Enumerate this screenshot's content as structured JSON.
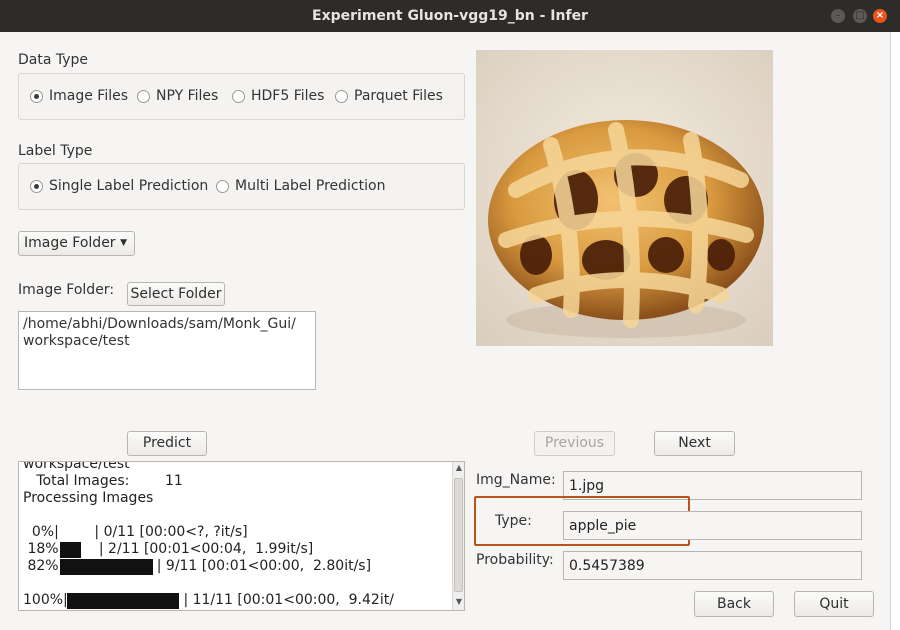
{
  "window": {
    "title": "Experiment Gluon-vgg19_bn - Infer",
    "minimize_glyph": "–",
    "maximize_glyph": "□",
    "close_glyph": "×"
  },
  "data_type": {
    "label": "Data Type",
    "options": [
      "Image Files",
      "NPY Files",
      "HDF5 Files",
      "Parquet Files"
    ],
    "selected": "Image Files"
  },
  "label_type": {
    "label": "Label Type",
    "options": [
      "Single Label Prediction",
      "Multi Label Prediction"
    ],
    "selected": "Single Label Prediction"
  },
  "source_dropdown": {
    "value": "Image Folder"
  },
  "image_folder": {
    "label": "Image Folder:",
    "button": "Select Folder",
    "path_line1": "/home/abhi/Downloads/sam/Monk_Gui/",
    "path_line2": "workspace/test"
  },
  "buttons": {
    "predict": "Predict",
    "previous": "Previous",
    "next": "Next",
    "back": "Back",
    "quit": "Quit"
  },
  "console": {
    "lines": [
      "workspace/test",
      "   Total Images:        11",
      "Processing Images",
      "",
      "  0%|        | 0/11 [00:00<?, ?it/s]",
      " 18%|        | 2/11 [00:01<00:04,  1.99it/s]",
      " 82%|                     | 9/11 [00:01<00:00,  2.80it/s]",
      "",
      "100%|                          | 11/11 [00:01<00:00,  9.42it/"
    ]
  },
  "result": {
    "img_name_label": "Img_Name:",
    "img_name": "1.jpg",
    "type_label": "Type:",
    "type": "apple_pie",
    "probability_label": "Probability:",
    "probability": "0.5457389"
  },
  "colors": {
    "titlebar": "#2d2c29",
    "close_button": "#e95420",
    "highlight_box": "#b9541e"
  }
}
